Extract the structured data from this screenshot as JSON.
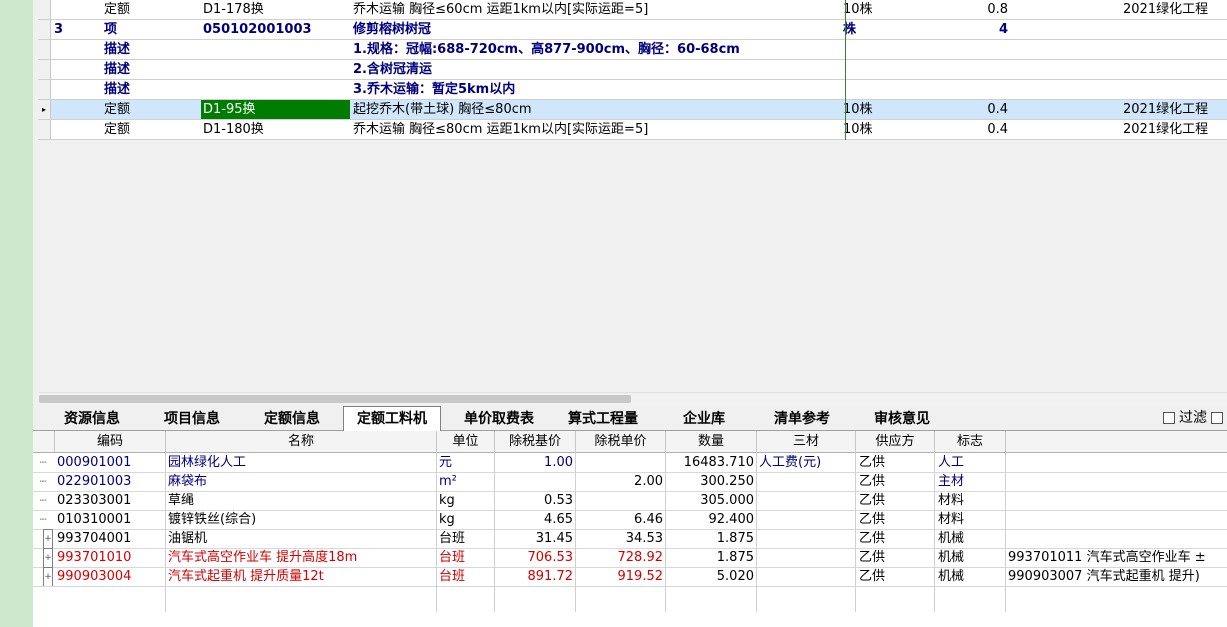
{
  "upper_rows": [
    {
      "no": "",
      "type": "定额",
      "code": "D1-178换",
      "name": "乔木运输 胸径≤60cm 运距1km以内[实际运距=5]",
      "unit": "10株",
      "qty": "0.8",
      "proj": "2021绿化工程"
    },
    {
      "no": "3",
      "type": "项",
      "code": "050102001003",
      "name": "修剪榕树树冠",
      "unit": "株",
      "qty": "4",
      "proj": ""
    },
    {
      "no": "",
      "type": "描述",
      "code": "",
      "name": "1.规格：冠幅:688-720cm、高877-900cm、胸径：60-68cm",
      "unit": "",
      "qty": "",
      "proj": ""
    },
    {
      "no": "",
      "type": "描述",
      "code": "",
      "name": "2.含树冠清运",
      "unit": "",
      "qty": "",
      "proj": ""
    },
    {
      "no": "",
      "type": "描述",
      "code": "",
      "name": "3.乔木运输：暂定5km以内",
      "unit": "",
      "qty": "",
      "proj": ""
    },
    {
      "no": "",
      "type": "定额",
      "code": "D1-95换",
      "name": "起挖乔木(带土球) 胸径≤80cm",
      "unit": "10株",
      "qty": "0.4",
      "proj": "2021绿化工程"
    },
    {
      "no": "",
      "type": "定额",
      "code": "D1-180换",
      "name": "乔木运输 胸径≤80cm 运距1km以内[实际运距=5]",
      "unit": "10株",
      "qty": "0.4",
      "proj": "2021绿化工程"
    }
  ],
  "tabs": [
    "资源信息",
    "项目信息",
    "定额信息",
    "定额工料机",
    "单价取费表",
    "算式工程量",
    "企业库",
    "清单参考",
    "审核意见"
  ],
  "active_tab": "定额工料机",
  "filter_label": "过滤",
  "lower_headers": [
    "编码",
    "名称",
    "单位",
    "除税基价",
    "除税单价",
    "数量",
    "三材",
    "供应方",
    "标志"
  ],
  "lower_rows": [
    {
      "code": "000901001",
      "name": "园林绿化人工",
      "unit": "元",
      "base_price": "1.00",
      "unit_price": "",
      "qty": "16483.710",
      "three_mat": "人工费(元)",
      "supplier": "乙供",
      "flag": "人工",
      "extra": ""
    },
    {
      "code": "022901003",
      "name": "麻袋布",
      "unit": "m²",
      "base_price": "",
      "unit_price": "2.00",
      "qty": "300.250",
      "three_mat": "",
      "supplier": "乙供",
      "flag": "主材",
      "extra": ""
    },
    {
      "code": "023303001",
      "name": "草绳",
      "unit": "kg",
      "base_price": "0.53",
      "unit_price": "",
      "qty": "305.000",
      "three_mat": "",
      "supplier": "乙供",
      "flag": "材料",
      "extra": ""
    },
    {
      "code": "010310001",
      "name": "镀锌铁丝(综合)",
      "unit": "kg",
      "base_price": "4.65",
      "unit_price": "6.46",
      "qty": "92.400",
      "three_mat": "",
      "supplier": "乙供",
      "flag": "材料",
      "extra": ""
    },
    {
      "code": "993704001",
      "name": "油锯机",
      "unit": "台班",
      "base_price": "31.45",
      "unit_price": "34.53",
      "qty": "1.875",
      "three_mat": "",
      "supplier": "乙供",
      "flag": "机械",
      "extra": ""
    },
    {
      "code": "993701010",
      "name": "汽车式高空作业车 提升高度18m",
      "unit": "台班",
      "base_price": "706.53",
      "unit_price": "728.92",
      "qty": "1.875",
      "three_mat": "",
      "supplier": "乙供",
      "flag": "机械",
      "extra": "993701011  汽车式高空作业车 ±"
    },
    {
      "code": "990903004",
      "name": "汽车式起重机 提升质量12t",
      "unit": "台班",
      "base_price": "891.72",
      "unit_price": "919.52",
      "qty": "5.020",
      "three_mat": "",
      "supplier": "乙供",
      "flag": "机械",
      "extra": "990903007  汽车式起重机 提升)"
    }
  ],
  "colors": {
    "selected_row": "#cfe6fb",
    "highlight_code": "#007d00",
    "red_text": "#d40000",
    "blue_text": "#00007f",
    "left_strip": "#cde8cd"
  }
}
